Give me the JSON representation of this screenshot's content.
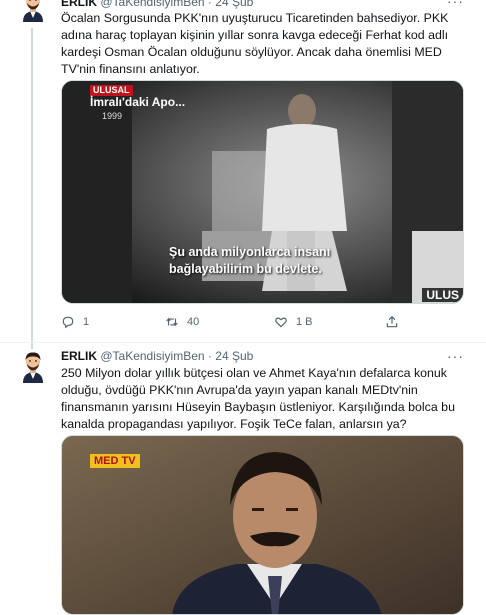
{
  "tweets": [
    {
      "name": "ERLIK",
      "handle": "@TaKendisiyimBen",
      "separator": "·",
      "date": "24 Şub",
      "text": "Öcalan Sorgusunda PKK'nın uyuşturucu Ticaretinden bahsediyor. PKK adına haraç toplayan kişinin yıllar sonra kavga edeceği Ferhat kod adlı kardeşi Osman Öcalan olduğunu söylüyor. Ancak daha önemlisi MED TV'nin finansını anlatıyor.",
      "media": {
        "channel_logo": "ULUSAL",
        "caption_title": "İmralı'daki Apo...",
        "year": "1999",
        "subtitle_line1": "Şu anda milyonlarca insanı",
        "subtitle_line2": "bağlayabilirim bu devlete.",
        "corner_logo": "ULUS"
      },
      "actions": {
        "reply_count": "1",
        "retweet_count": "40",
        "like_count": "1 B"
      }
    },
    {
      "name": "ERLIK",
      "handle": "@TaKendisiyimBen",
      "separator": "·",
      "date": "24 Şub",
      "text": "250 Milyon dolar yıllık bütçesi olan ve Ahmet Kaya'nın defalarca konuk olduğu, övdüğü PKK'nın Avrupa'da yayın yapan kanalı MEDtv'nin finansmanın yarısını Hüseyin Baybaşın üstleniyor. Karşılığında bolca bu kanalda propagandası yapılıyor. Foşik TeCe falan, anlarsın ya?",
      "media": {
        "channel_logo": "MED TV"
      }
    }
  ],
  "colors": {
    "text_primary": "#0f1419",
    "text_secondary": "#536471",
    "divider": "#eff3f4"
  }
}
